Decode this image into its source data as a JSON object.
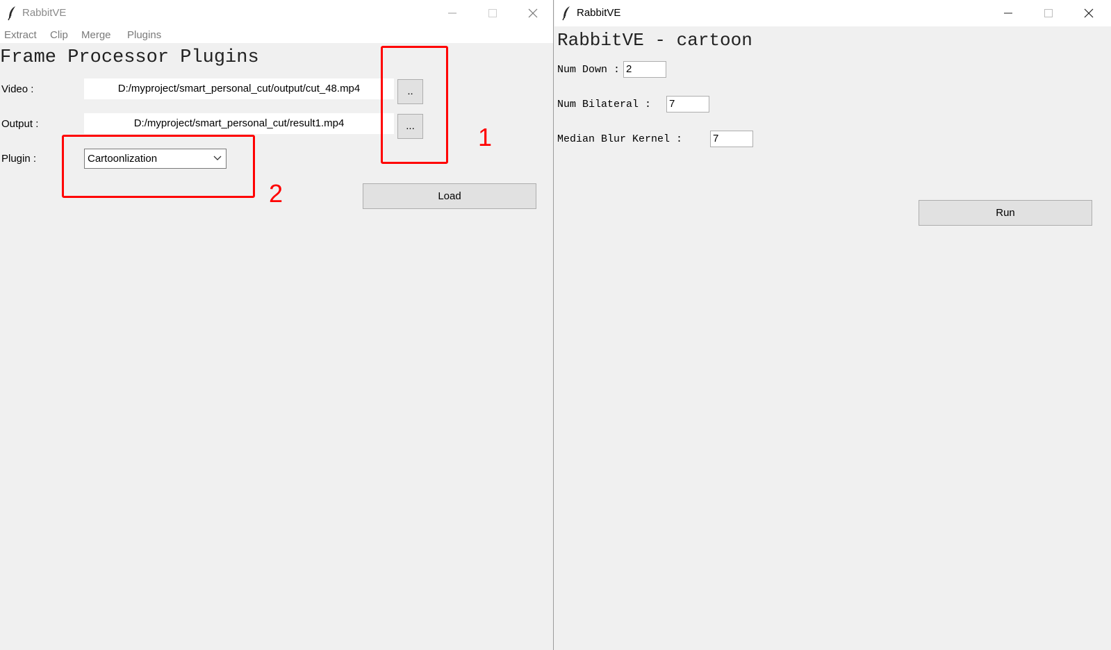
{
  "main_window": {
    "title": "RabbitVE",
    "icon": "feather-icon",
    "menu": [
      "Extract",
      "Clip",
      "Merge",
      "Plugins"
    ],
    "heading": "Frame Processor Plugins",
    "video_label": "Video :",
    "video_value": "D:/myproject/smart_personal_cut/output/cut_48.mp4",
    "video_browse": "..",
    "output_label": "Output :",
    "output_value": "D:/myproject/smart_personal_cut/result1.mp4",
    "output_browse": "...",
    "plugin_label": "Plugin :",
    "plugin_selected": "Cartoonlization",
    "load_button": "Load"
  },
  "annotations": {
    "marker1": "1",
    "marker2": "2",
    "color": "#ff0000"
  },
  "cartoon_window": {
    "title": "RabbitVE",
    "heading": "RabbitVE - cartoon",
    "num_down_label": "Num Down :",
    "num_down_value": "2",
    "num_bilateral_label": "Num Bilateral :",
    "num_bilateral_value": "7",
    "median_blur_label": "Median Blur Kernel :",
    "median_blur_value": "7",
    "run_button": "Run"
  }
}
